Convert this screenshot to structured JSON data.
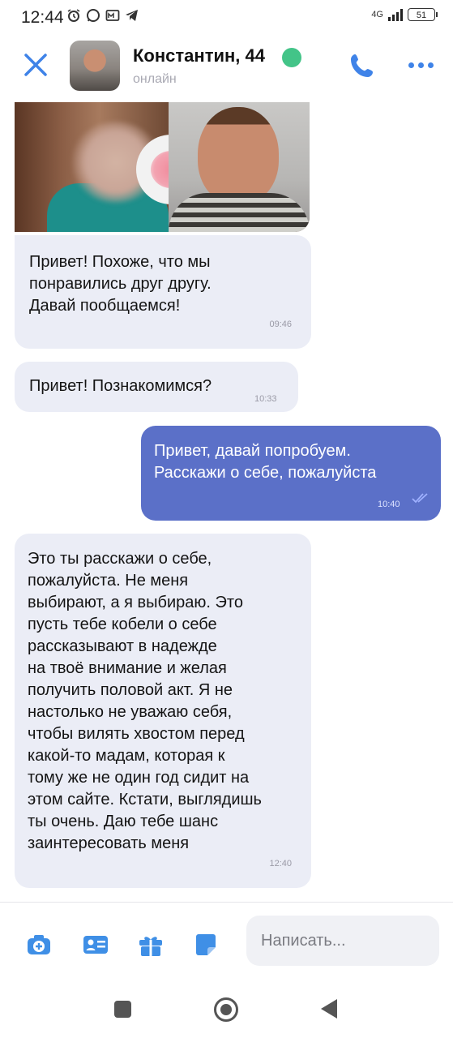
{
  "status_bar": {
    "time": "12:44",
    "network": "4G",
    "battery": "51",
    "icons": [
      "alarm-icon",
      "whatsapp-icon",
      "mail-icon",
      "telegram-icon"
    ]
  },
  "header": {
    "contact_name": "Константин, 44",
    "status": "онлайн",
    "accent_color": "#3f83e8",
    "online_color": "#43c488"
  },
  "messages": [
    {
      "direction": "incoming",
      "text": "Привет! Похоже, что мы\nпонравились друг другу.\nДавай пообщаемся!",
      "time": "09:46"
    },
    {
      "direction": "incoming",
      "text": "Привет! Познакомимся?",
      "time": "10:33"
    },
    {
      "direction": "outgoing",
      "text": "Привет, давай попробуем.\nРасскажи о себе, пожалуйста",
      "time": "10:40",
      "read": true
    },
    {
      "direction": "incoming",
      "text": "Это ты расскажи о себе,\nпожалуйста. Не меня\nвыбирают, а я выбираю. Это\nпусть тебе кобели о себе\nрассказывают в надежде\nна твоё внимание и желая\nполучить половой акт. Я не\nнастолько не уважаю себя,\nчтобы вилять хвостом перед\nкакой-то мадам, которая к\nтому же не один год сидит на\nэтом сайте. Кстати, выглядишь\nты очень. Даю тебе шанс\nзаинтересовать меня",
      "time": "12:40"
    }
  ],
  "composer": {
    "placeholder": "Написать...",
    "tools": [
      "camera-icon",
      "contact-card-icon",
      "gift-icon",
      "sticker-icon"
    ]
  },
  "colors": {
    "incoming_bubble": "#ebedf6",
    "outgoing_bubble": "#5b70c8"
  }
}
